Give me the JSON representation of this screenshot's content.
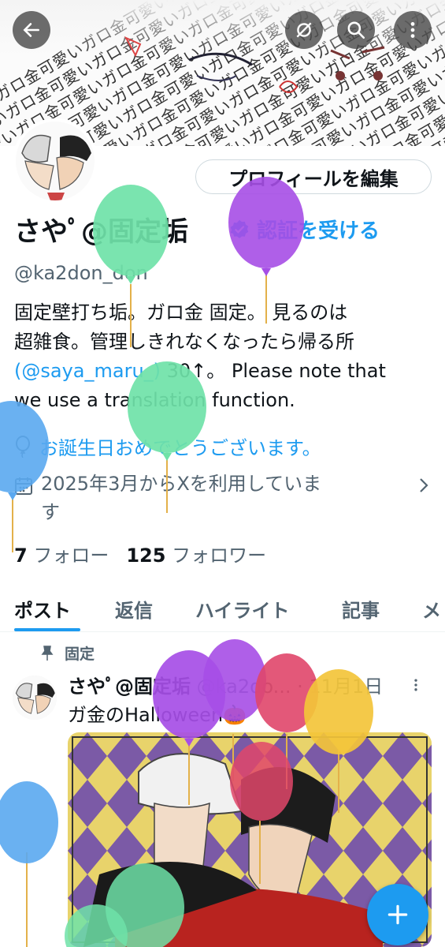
{
  "banner": {
    "pattern_text": "ガロ金可愛い"
  },
  "profile": {
    "edit_button": "プロフィールを編集",
    "name": "さやﾟ@固定垢",
    "verify_label": "認証を受ける",
    "handle": "@ka2don_don",
    "bio_line1": "固定壁打ち垢。ガロ金 固定。 見るのは",
    "bio_line2": "超雑食。管理しきれなくなったら帰る所",
    "bio_mention": "(@saya_maru_)",
    "bio_line3_rest": " 30↑。  Please note that",
    "bio_line4": "we use a translation function.",
    "birthday": "お誕生日おめでとうございます。",
    "joined_line1": "2025年3月からXを利用していま",
    "joined_line2": "す",
    "following_count": "7",
    "following_label": "フォロー",
    "followers_count": "125",
    "followers_label": "フォロワー"
  },
  "tabs": [
    {
      "label": "ポスト",
      "active": true
    },
    {
      "label": "返信"
    },
    {
      "label": "ハイライト"
    },
    {
      "label": "記事"
    },
    {
      "label": "メ"
    }
  ],
  "post": {
    "pinned_label": "固定",
    "author_name": "さやﾟ@固定垢",
    "author_handle": "@ka2do...",
    "dot": "·",
    "date": "11月1日",
    "text": "ガ金のHalloween🎃"
  },
  "icons": [
    "back-arrow-icon",
    "hide-icon",
    "search-icon",
    "more-icon",
    "verified-badge-icon",
    "balloon-icon",
    "calendar-icon",
    "chevron-right-icon",
    "pin-icon",
    "plus-icon"
  ],
  "colors": {
    "accent": "#1d9bf0",
    "secondary_text": "#536471",
    "text": "#0f1419"
  }
}
